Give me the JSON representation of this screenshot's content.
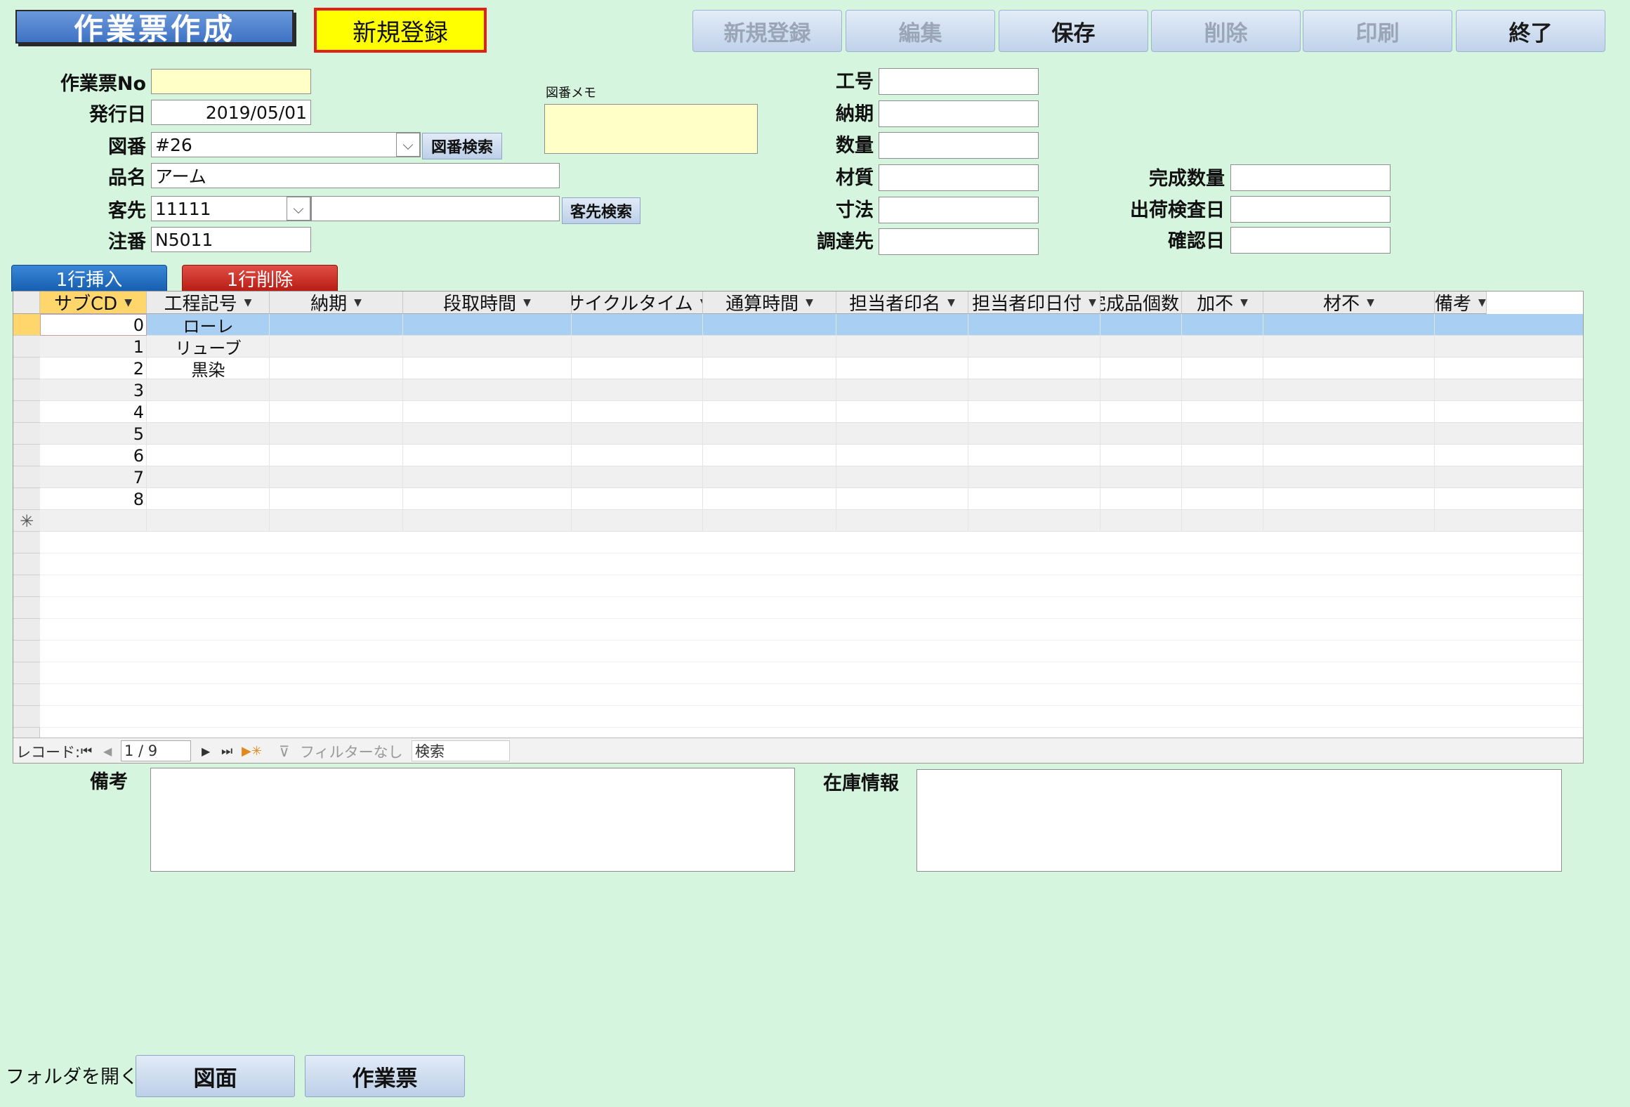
{
  "header": {
    "title": "作業票作成",
    "mode": "新規登録",
    "buttons": [
      {
        "label": "新規登録",
        "enabled": false
      },
      {
        "label": "編集",
        "enabled": false
      },
      {
        "label": "保存",
        "enabled": true
      },
      {
        "label": "削除",
        "enabled": false
      },
      {
        "label": "印刷",
        "enabled": false
      },
      {
        "label": "終了",
        "enabled": true
      }
    ]
  },
  "form": {
    "work_no": {
      "label": "作業票No",
      "value": ""
    },
    "issue_date": {
      "label": "発行日",
      "value": "2019/05/01"
    },
    "drawing_no": {
      "label": "図番",
      "value": "#26",
      "search_button": "図番検索"
    },
    "product_name": {
      "label": "品名",
      "value": "アーム"
    },
    "customer": {
      "label": "客先",
      "code": "11111",
      "name": "",
      "search_button": "客先検索"
    },
    "order_no": {
      "label": "注番",
      "value": "N5011"
    },
    "drawing_memo": {
      "label": "図番メモ",
      "value": ""
    },
    "job_no": {
      "label": "工号",
      "value": ""
    },
    "due_date": {
      "label": "納期",
      "value": ""
    },
    "quantity": {
      "label": "数量",
      "value": ""
    },
    "material": {
      "label": "材質",
      "value": ""
    },
    "dimensions": {
      "label": "寸法",
      "value": ""
    },
    "supplier": {
      "label": "調達先",
      "value": ""
    },
    "completed_qty": {
      "label": "完成数量",
      "value": ""
    },
    "shipping_inspection_date": {
      "label": "出荷検査日",
      "value": ""
    },
    "confirmation_date": {
      "label": "確認日",
      "value": ""
    }
  },
  "row_buttons": {
    "insert": "1行挿入",
    "delete": "1行削除"
  },
  "grid": {
    "columns": [
      "サブCD",
      "工程記号",
      "納期",
      "段取時間",
      "サイクルタイム",
      "通算時間",
      "担当者印名",
      "担当者印日付",
      "完成品個数",
      "加不",
      "材不",
      "備考"
    ],
    "rows": [
      {
        "sub_cd": "0",
        "process": "ローレ"
      },
      {
        "sub_cd": "1",
        "process": "リューブ"
      },
      {
        "sub_cd": "2",
        "process": "黒染"
      },
      {
        "sub_cd": "3",
        "process": ""
      },
      {
        "sub_cd": "4",
        "process": ""
      },
      {
        "sub_cd": "5",
        "process": ""
      },
      {
        "sub_cd": "6",
        "process": ""
      },
      {
        "sub_cd": "7",
        "process": ""
      },
      {
        "sub_cd": "8",
        "process": ""
      }
    ],
    "new_row_marker": "✳",
    "navigation": {
      "record_label": "レコード:",
      "position": "1 / 9",
      "filter_label": "フィルターなし",
      "search_placeholder": "検索"
    }
  },
  "notes": {
    "label": "備考",
    "value": ""
  },
  "inventory": {
    "label": "在庫情報",
    "value": ""
  },
  "footer": {
    "open_folder_label": "フォルダを開く",
    "drawing_button": "図面",
    "worksheet_button": "作業票"
  },
  "colors": {
    "background": "#d6f5df",
    "title": "#4a82d0",
    "mode_bg": "#ffff00",
    "mode_border": "#e0201b",
    "selected_row": "#a9cff2",
    "insert_button": "#2a74c6",
    "delete_button": "#d2322b"
  }
}
